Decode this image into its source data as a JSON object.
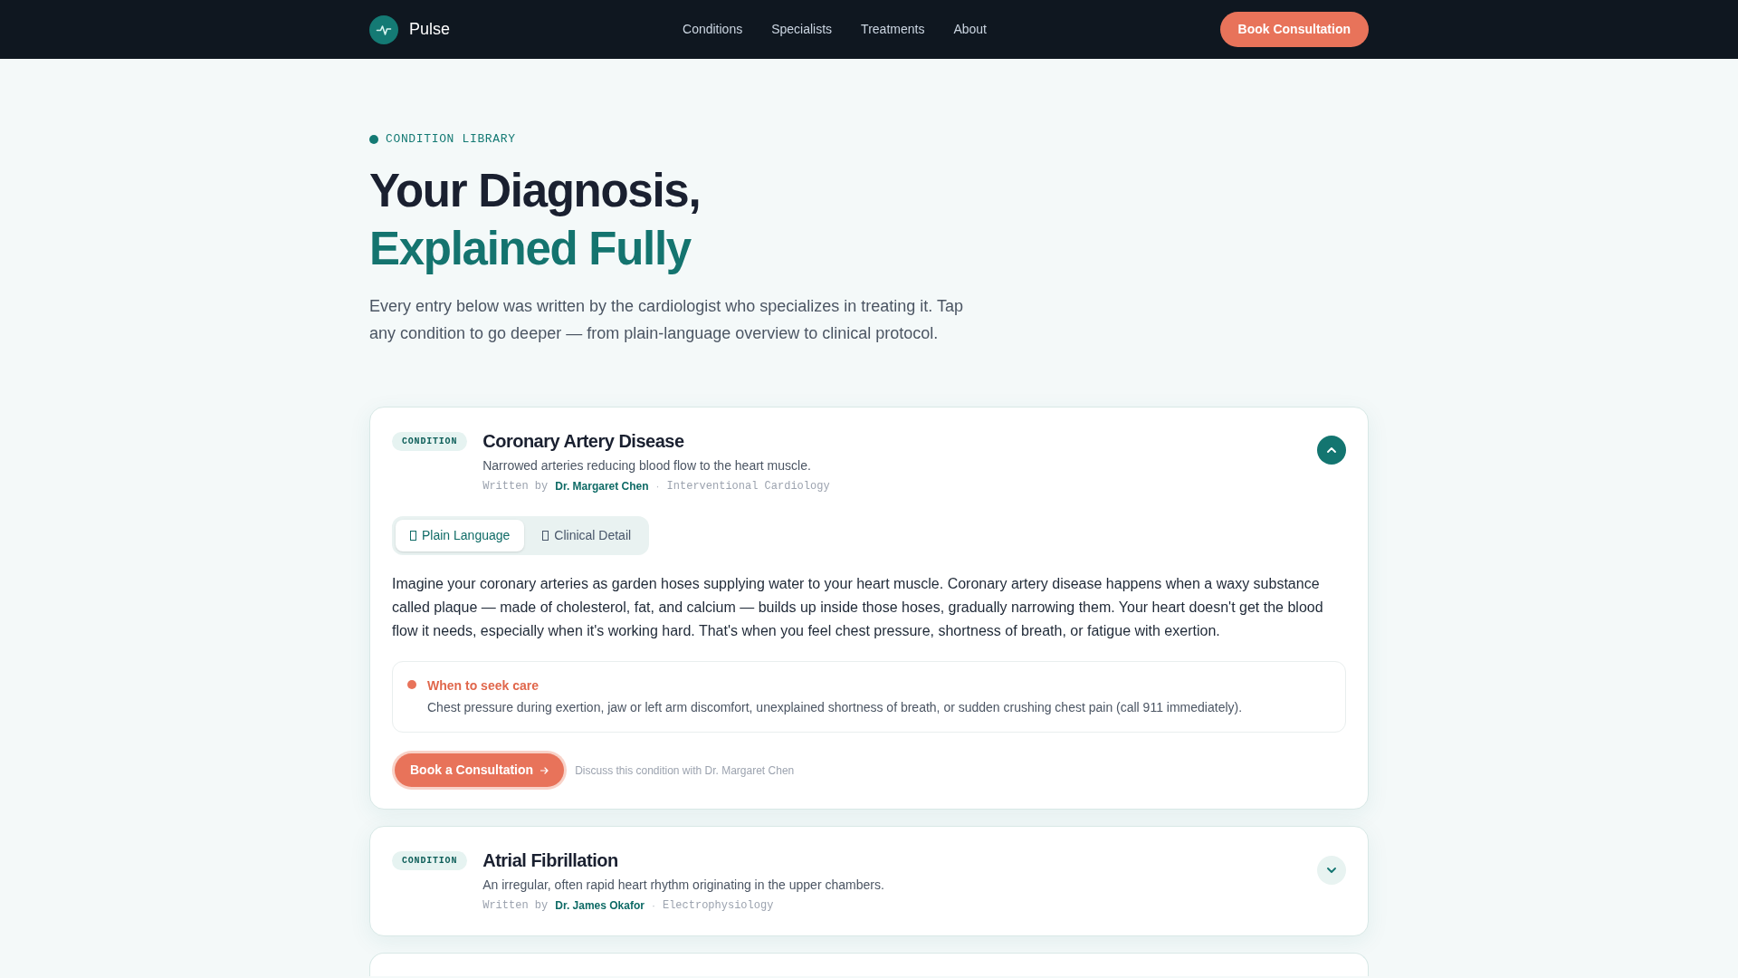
{
  "nav": {
    "brand": "Pulse",
    "links": [
      {
        "label": "Conditions"
      },
      {
        "label": "Specialists"
      },
      {
        "label": "Treatments"
      },
      {
        "label": "About"
      }
    ],
    "cta": "Book Consultation"
  },
  "hero": {
    "eyebrow": "CONDITION LIBRARY",
    "title_line_1": "Your Diagnosis,",
    "title_line_2": "Explained Fully",
    "intro": "Every entry below was written by the cardiologist who specializes in treating it. Tap any condition to go deeper — from plain-language overview to clinical protocol."
  },
  "conditions": [
    {
      "badge": "CONDITION",
      "title": "Coronary Artery Disease",
      "summary": "Narrowed arteries reducing blood flow to the heart muscle.",
      "byline_label": "Written by",
      "author": "Dr. Margaret Chen",
      "separator": "·",
      "specialty": "Interventional Cardiology",
      "expanded": true,
      "tabs": [
        {
          "label": "Plain Language",
          "selected": true
        },
        {
          "label": "Clinical Detail",
          "selected": false
        }
      ],
      "body": "Imagine your coronary arteries as garden hoses supplying water to your heart muscle. Coronary artery disease happens when a waxy substance called plaque — made of cholesterol, fat, and calcium — builds up inside those hoses, gradually narrowing them. Your heart doesn't get the blood flow it needs, especially when it's working hard. That's when you feel chest pressure, shortness of breath, or fatigue with exertion.",
      "alert": {
        "title": "When to seek care",
        "text": "Chest pressure during exertion, jaw or left arm discomfort, unexplained shortness of breath, or sudden crushing chest pain (call 911 immediately)."
      },
      "cta": {
        "label": "Book a Consultation",
        "note": "Discuss this condition with Dr. Margaret Chen"
      }
    },
    {
      "badge": "CONDITION",
      "title": "Atrial Fibrillation",
      "summary": "An irregular, often rapid heart rhythm originating in the upper chambers.",
      "byline_label": "Written by",
      "author": "Dr. James Okafor",
      "separator": "·",
      "specialty": "Electrophysiology",
      "expanded": false
    }
  ]
}
